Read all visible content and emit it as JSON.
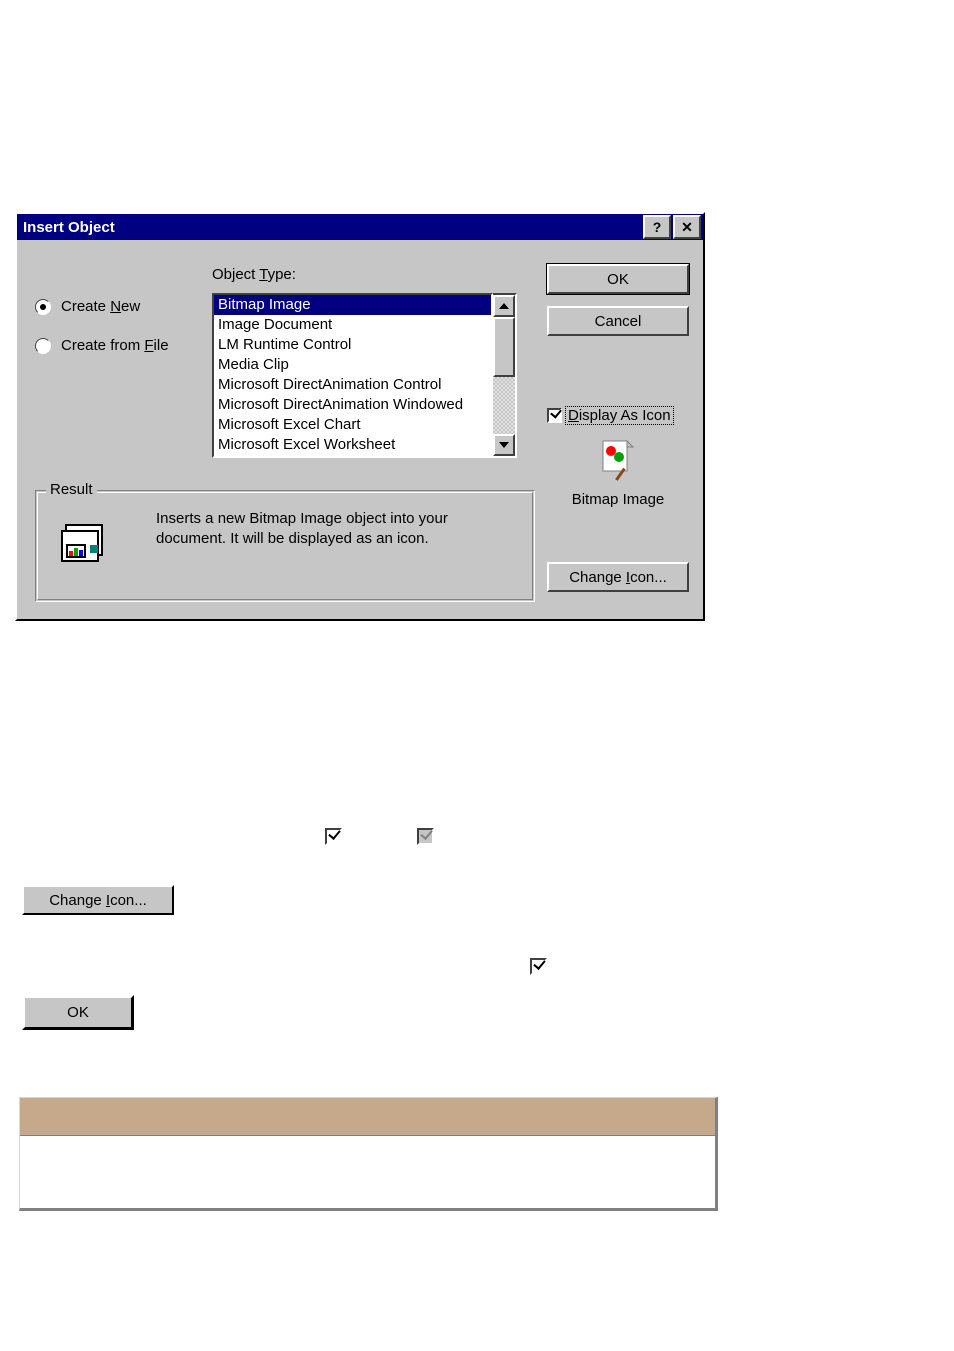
{
  "dialog": {
    "title": "Insert Object",
    "radios": {
      "createNew": {
        "pre": "Create ",
        "accel": "N",
        "post": "ew",
        "selected": true
      },
      "createFromFile": {
        "pre": "Create from ",
        "accel": "F",
        "post": "ile",
        "selected": false
      }
    },
    "objectTypeLabel": {
      "pre": "Object ",
      "accel": "T",
      "post": "ype:"
    },
    "objectTypes": [
      "Bitmap Image",
      "Image Document",
      "LM Runtime Control",
      "Media Clip",
      "Microsoft DirectAnimation Control",
      "Microsoft DirectAnimation Windowed",
      "Microsoft Excel Chart",
      "Microsoft Excel Worksheet"
    ],
    "objectTypeSelectedIndex": 0,
    "buttons": {
      "ok": "OK",
      "cancel": "Cancel",
      "changeIcon": {
        "pre": "Change ",
        "accel": "I",
        "post": "con..."
      }
    },
    "displayAsIcon": {
      "checked": true,
      "accel": "D",
      "post": "isplay As Icon"
    },
    "preview": {
      "caption": "Bitmap Image"
    },
    "result": {
      "groupLabel": "Result",
      "text": "Inserts a new Bitmap Image object into your document.  It will be displayed as an icon."
    }
  },
  "floating": {
    "changeIconBtn": {
      "pre": "Change ",
      "accel": "I",
      "post": "con..."
    },
    "okBtn": "OK"
  }
}
